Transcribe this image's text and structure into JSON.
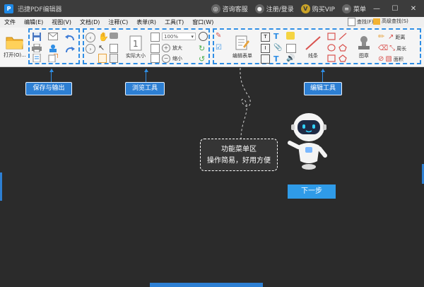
{
  "titlebar": {
    "app_title": "迅捷PDF编辑器",
    "consult": "咨询客服",
    "login": "注册/登录",
    "vip": "购买VIP",
    "menu": "菜单",
    "vip_badge": "V"
  },
  "menubar": {
    "items": [
      "文件",
      "编辑(E)",
      "视图(V)",
      "文档(D)",
      "注释(C)",
      "表单(R)",
      "工具(T)",
      "窗口(W)"
    ]
  },
  "toolbar": {
    "open_label": "打开(O)...",
    "actual_size_label": "实际大小",
    "zoom_value": "100%",
    "zoom_in_label": "放大",
    "zoom_out_label": "缩小",
    "edit_form_label": "编辑表单",
    "lines_label": "线条",
    "stamp_label": "图章",
    "find_label": "查找(F)",
    "advanced_find_label": "高级查找(S)",
    "distance_label": "距离",
    "perimeter_label": "周长",
    "area_label": "面积"
  },
  "callouts": {
    "save_output": "保存与输出",
    "browse_tools": "浏览工具",
    "edit_tools": "编辑工具"
  },
  "guide": {
    "line1": "功能菜单区",
    "line2": "操作简易，好用方便",
    "next_button": "下一步"
  },
  "colors": {
    "accent": "#2f8ee5",
    "overlay": "#2b2b2b",
    "next_button": "#2f9be8"
  }
}
